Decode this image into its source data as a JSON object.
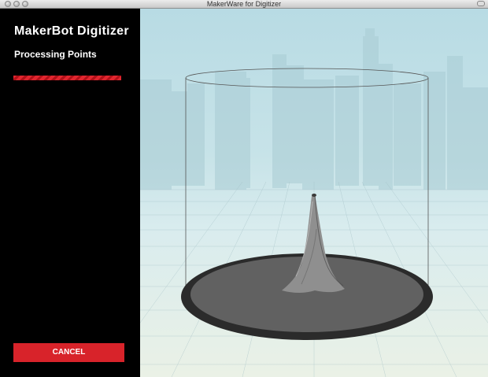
{
  "window": {
    "title": "MakerWare for Digitizer"
  },
  "sidebar": {
    "brand": "MakerBot Digitizer",
    "status": "Processing Points",
    "progress": 1.0,
    "cancel_label": "CANCEL"
  },
  "colors": {
    "accent_red": "#d8232a",
    "sidebar_bg": "#000000",
    "sky": "#b8dbe4"
  }
}
